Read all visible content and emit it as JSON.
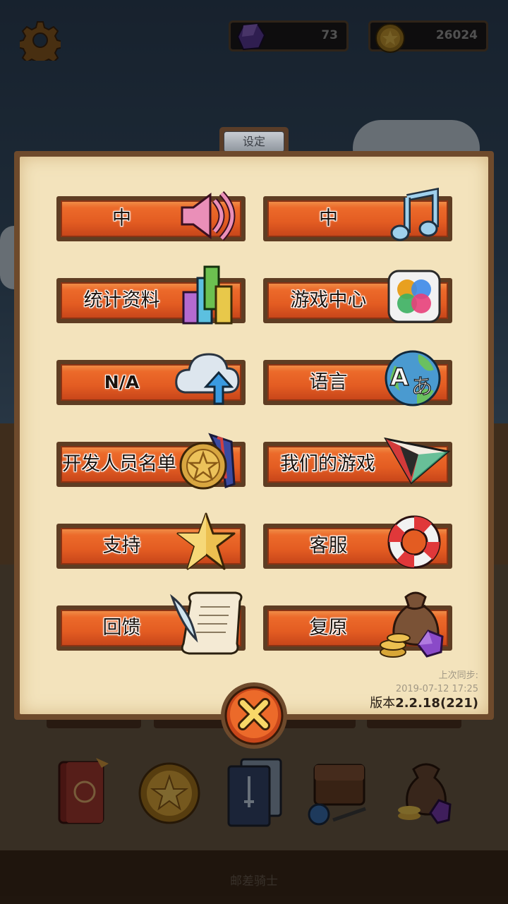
{
  "top_bar": {
    "settings_icon": "gear-icon",
    "gems": {
      "icon": "gem-icon",
      "value": "73"
    },
    "coins": {
      "icon": "coin-icon",
      "value": "26024"
    }
  },
  "dialog": {
    "tab_title": "设定",
    "buttons": [
      {
        "id": "sound",
        "label": "中",
        "icon": "speaker-icon"
      },
      {
        "id": "music",
        "label": "中",
        "icon": "music-note-icon"
      },
      {
        "id": "stats",
        "label": "统计资料",
        "icon": "bar-chart-icon"
      },
      {
        "id": "game-center",
        "label": "游戏中心",
        "icon": "game-center-icon"
      },
      {
        "id": "cloud",
        "label": "N/A",
        "icon": "cloud-upload-icon"
      },
      {
        "id": "language",
        "label": "语言",
        "icon": "globe-language-icon"
      },
      {
        "id": "credits",
        "label": "开发人员名单",
        "icon": "medal-icon"
      },
      {
        "id": "our-games",
        "label": "我们的游戏",
        "icon": "paper-plane-icon"
      },
      {
        "id": "support",
        "label": "支持",
        "icon": "star-icon"
      },
      {
        "id": "customer-service",
        "label": "客服",
        "icon": "lifebuoy-icon"
      },
      {
        "id": "feedback",
        "label": "回馈",
        "icon": "scroll-quill-icon"
      },
      {
        "id": "restore",
        "label": "复原",
        "icon": "treasure-bag-icon"
      }
    ],
    "sync_label": "上次同步:",
    "sync_time": "2019-07-12 17:25",
    "version_prefix": "版本",
    "version_number": "2.2.18(221)",
    "close_icon": "close-x-icon"
  },
  "bottom_items": [
    "book-icon",
    "star-coin-icon",
    "cards-icon",
    "backpack-icon",
    "loot-bag-icon"
  ],
  "footer_text": "邮差骑士",
  "colors": {
    "button_orange": "#e35c22",
    "panel_parchment": "#f3e3bc",
    "frame_brown": "#6e4a2c"
  }
}
